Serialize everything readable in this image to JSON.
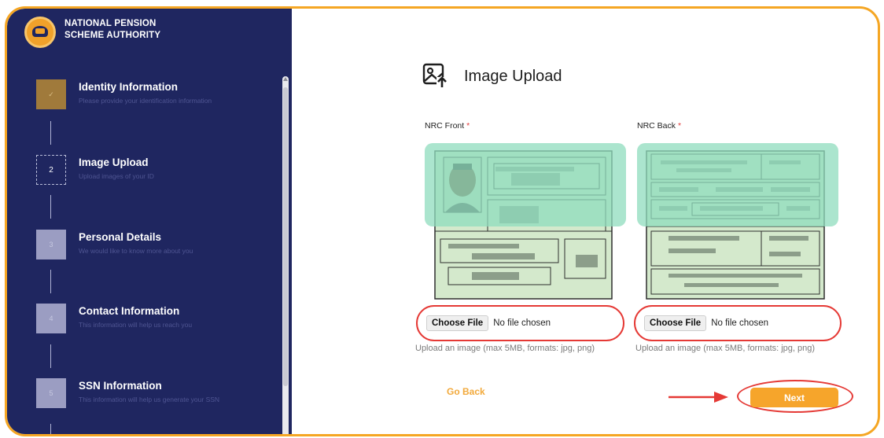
{
  "org": {
    "name_line1": "NATIONAL PENSION",
    "name_line2": "SCHEME AUTHORITY"
  },
  "steps": [
    {
      "marker": "✓",
      "title": "Identity Information",
      "subtitle": "Please provide your identification information",
      "state": "done"
    },
    {
      "marker": "2",
      "title": "Image Upload",
      "subtitle": "Upload images of your ID",
      "state": "active"
    },
    {
      "marker": "3",
      "title": "Personal Details",
      "subtitle": "We would like to know more about you",
      "state": "pending"
    },
    {
      "marker": "4",
      "title": "Contact Information",
      "subtitle": "This information will help us reach you",
      "state": "pending"
    },
    {
      "marker": "5",
      "title": "SSN Information",
      "subtitle": "This information will help us generate your SSN",
      "state": "pending"
    }
  ],
  "main": {
    "title": "Image Upload",
    "front": {
      "label": "NRC Front",
      "required": "*",
      "choose_label": "Choose File",
      "status": "No file chosen",
      "helper": "Upload an image (max 5MB, formats: jpg, png)"
    },
    "back": {
      "label": "NRC Back",
      "required": "*",
      "choose_label": "Choose File",
      "status": "No file chosen",
      "helper": "Upload an image (max 5MB, formats: jpg, png)"
    },
    "go_back": "Go Back",
    "next": "Next"
  },
  "colors": {
    "sidebar": "#1f2660",
    "accent": "#f6a52b",
    "highlight": "#e53935",
    "id_green": "#d4e9cc",
    "id_overlay": "#9fe0c6"
  }
}
